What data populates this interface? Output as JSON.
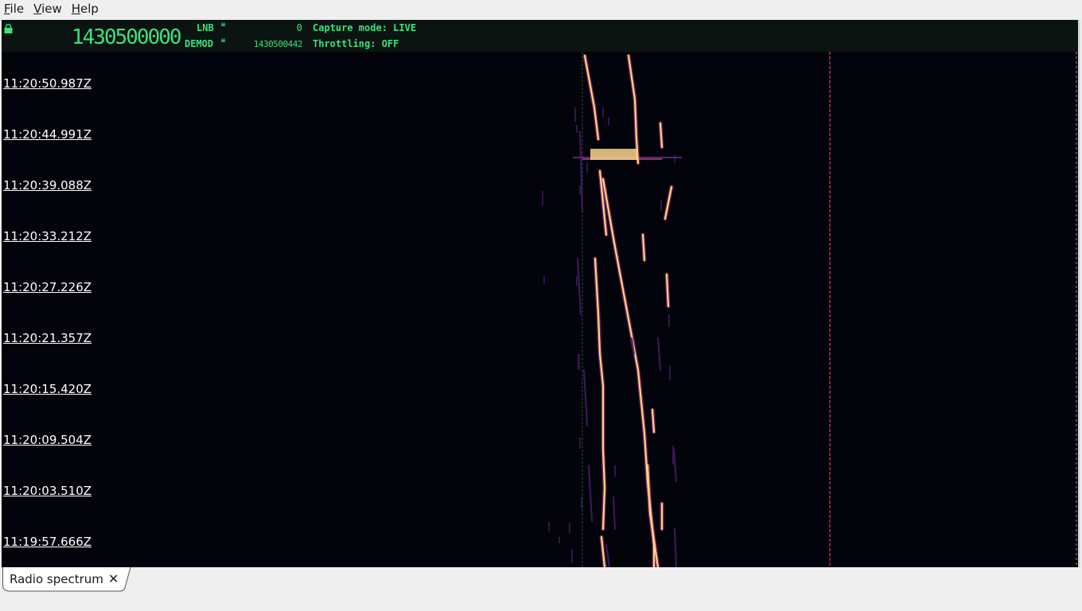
{
  "menubar": {
    "items": [
      {
        "label": "File",
        "accel": "F",
        "rest": "ile"
      },
      {
        "label": "View",
        "accel": "V",
        "rest": "iew"
      },
      {
        "label": "Help",
        "accel": "H",
        "rest": "elp"
      }
    ]
  },
  "header": {
    "main_frequency": "1430500000",
    "lnb_label": "LNB",
    "lnb_value": "0",
    "demod_label": "DEMOD",
    "demod_value": "1430500442",
    "capture_mode": "Capture mode: LIVE",
    "throttling": "Throttling: OFF",
    "accent_color": "#3de07d"
  },
  "waterfall": {
    "timestamps": [
      "11:20:50.987Z",
      "11:20:44.991Z",
      "11:20:39.088Z",
      "11:20:33.212Z",
      "11:20:27.226Z",
      "11:20:21.357Z",
      "11:20:15.420Z",
      "11:20:09.504Z",
      "11:20:03.510Z",
      "11:19:57.666Z"
    ],
    "palette": {
      "background": "#03040b",
      "low": "#4a1a6a",
      "mid": "#c23c81",
      "high": "#fcd38c",
      "marker": "#c8324a"
    }
  },
  "tabs": [
    {
      "label": "Radio spectrum",
      "close_icon": "close-icon",
      "active": true
    }
  ]
}
